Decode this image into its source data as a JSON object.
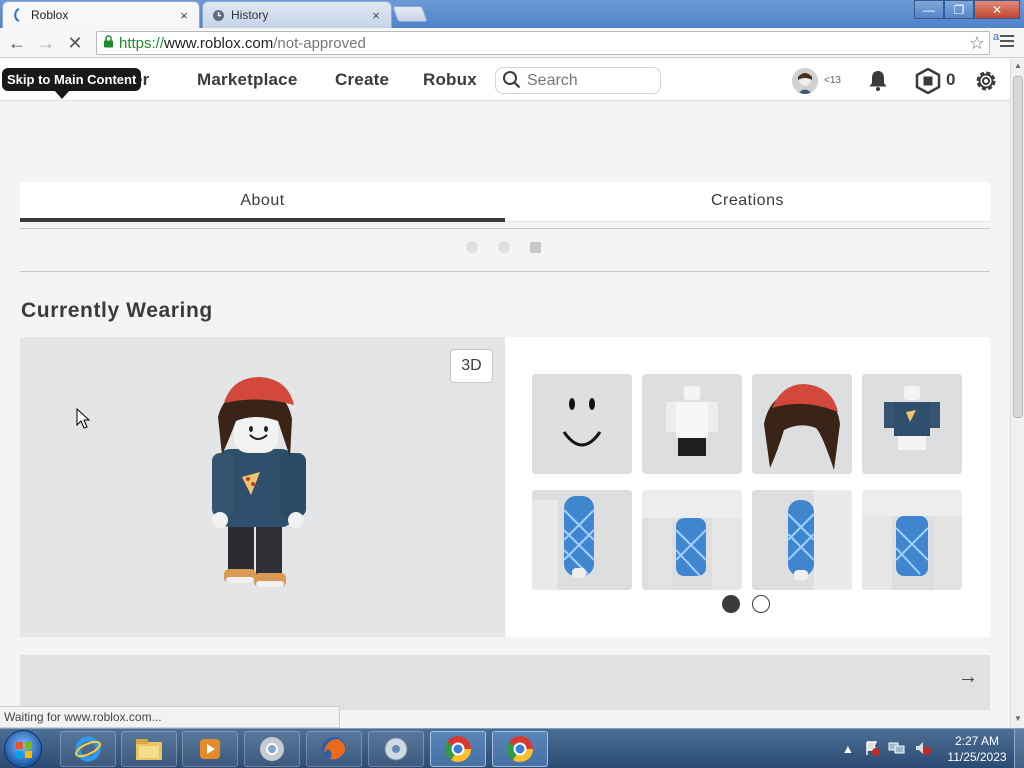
{
  "browser": {
    "tabs": [
      {
        "label": "Roblox",
        "close": "×",
        "favicon": "roblox-icon"
      },
      {
        "label": "History",
        "close": "×",
        "favicon": "clock-icon"
      }
    ],
    "url": {
      "scheme": "https://",
      "domain": "www.roblox.com",
      "path": "/not-approved"
    },
    "window_controls": {
      "minimize": "—",
      "maximize": "❐",
      "close": "✕"
    },
    "ext_badge": "a",
    "status_text": "Waiting for www.roblox.com..."
  },
  "roblox": {
    "skip_link": "Skip to Main Content",
    "nav": {
      "discover_partial": "er",
      "marketplace": "Marketplace",
      "create": "Create",
      "robux": "Robux"
    },
    "search_placeholder": "Search",
    "age_badge": "<13",
    "robux_count": "0",
    "profile_tabs": {
      "about": "About",
      "creations": "Creations"
    },
    "section_title": "Currently Wearing",
    "view_toggle": "3D",
    "wearing_pages": {
      "current": 1,
      "total": 2
    },
    "next_arrow": "→",
    "items": [
      {
        "name": "face"
      },
      {
        "name": "white-shirt-with-dark-pants"
      },
      {
        "name": "red-beanie-with-brown-hair"
      },
      {
        "name": "blue-pizza-hoodie"
      },
      {
        "name": "left-arm"
      },
      {
        "name": "left-leg"
      },
      {
        "name": "right-arm"
      },
      {
        "name": "right-leg"
      }
    ]
  },
  "taskbar": {
    "clock_time": "2:27 AM",
    "clock_date": "11/25/2023",
    "apps": [
      "internet-explorer",
      "file-explorer",
      "media-player",
      "chrome",
      "firefox",
      "media-center",
      "chrome",
      "chrome"
    ]
  },
  "colors": {
    "accent": "#393b3d",
    "secure_green": "#1e8c2f",
    "page_bg": "#f2f4f5"
  }
}
